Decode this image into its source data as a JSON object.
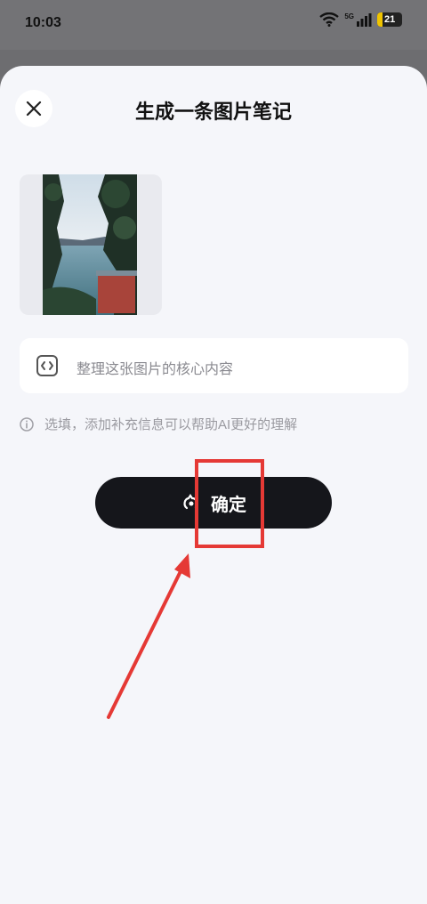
{
  "status_bar": {
    "time": "10:03",
    "network": "5G",
    "battery": "21"
  },
  "sheet": {
    "title": "生成一条图片笔记"
  },
  "prompt": {
    "placeholder": "整理这张图片的核心内容"
  },
  "hint": {
    "text": "选填，添加补充信息可以帮助AI更好的理解"
  },
  "confirm_button": {
    "label": "确定"
  },
  "colors": {
    "highlight": "#e53935",
    "button_bg": "#15161b",
    "sheet_bg": "#f5f6fa"
  },
  "icons": [
    "close-icon",
    "wifi-icon",
    "signal-icon",
    "battery-icon",
    "code-icon",
    "info-icon",
    "sparkle-icon"
  ]
}
